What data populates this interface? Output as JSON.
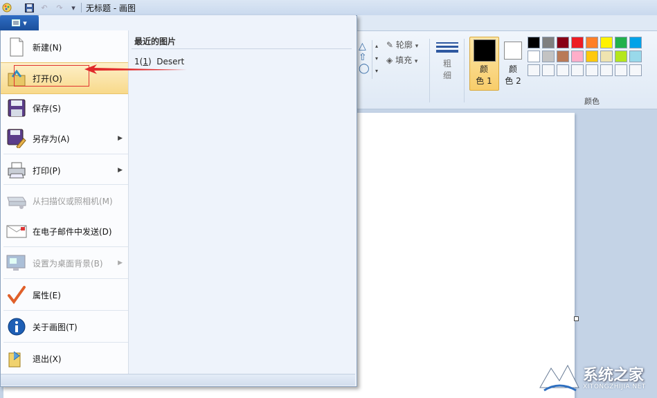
{
  "window": {
    "title": "无标题 - 画图"
  },
  "ribbon": {
    "outline_label": "轮廓",
    "fill_label": "填充",
    "size_label_1": "粗",
    "size_label_2": "细",
    "color1_label_1": "颜",
    "color1_label_2": "色 1",
    "color2_label_1": "颜",
    "color2_label_2": "色 2",
    "colors_group_label": "颜色",
    "palette_row1": [
      "#000000",
      "#7f7f7f",
      "#880015",
      "#ed1c24",
      "#ff7f27",
      "#fff200",
      "#22b14c",
      "#00a2e8"
    ],
    "palette_row2": [
      "#ffffff",
      "#c3c3c3",
      "#b97a57",
      "#ffaec9",
      "#ffc90e",
      "#efe4b0",
      "#b5e61d",
      "#99d9ea"
    ],
    "palette_row3": [
      "#f5f7fa",
      "#f5f7fa",
      "#f5f7fa",
      "#f5f7fa",
      "#f5f7fa",
      "#f5f7fa",
      "#f5f7fa",
      "#f5f7fa"
    ]
  },
  "menu": {
    "items": [
      {
        "label": "新建(N)",
        "icon": "new-file-icon",
        "disabled": false
      },
      {
        "label": "打开(O)",
        "icon": "open-folder-icon",
        "disabled": false,
        "highlighted": true
      },
      {
        "label": "保存(S)",
        "icon": "save-disk-icon",
        "disabled": false
      },
      {
        "label": "另存为(A)",
        "icon": "save-as-icon",
        "disabled": false,
        "submenu": true
      },
      {
        "label": "打印(P)",
        "icon": "printer-icon",
        "disabled": false,
        "submenu": true
      },
      {
        "label": "从扫描仪或照相机(M)",
        "icon": "scanner-icon",
        "disabled": true
      },
      {
        "label": "在电子邮件中发送(D)",
        "icon": "email-icon",
        "disabled": false
      },
      {
        "label": "设置为桌面背景(B)",
        "icon": "desktop-background-icon",
        "disabled": true,
        "submenu": true
      },
      {
        "label": "属性(E)",
        "icon": "checkmark-icon",
        "disabled": false
      },
      {
        "label": "关于画图(T)",
        "icon": "info-icon",
        "disabled": false
      },
      {
        "label": "退出(X)",
        "icon": "exit-icon",
        "disabled": false
      }
    ],
    "recent_title": "最近的图片",
    "recent_items": [
      {
        "index": "1",
        "index_underline": "1",
        "name": "Desert"
      }
    ]
  },
  "watermark": {
    "text": "系统之家",
    "subtext": "XITONGZHIJIA.NET"
  }
}
